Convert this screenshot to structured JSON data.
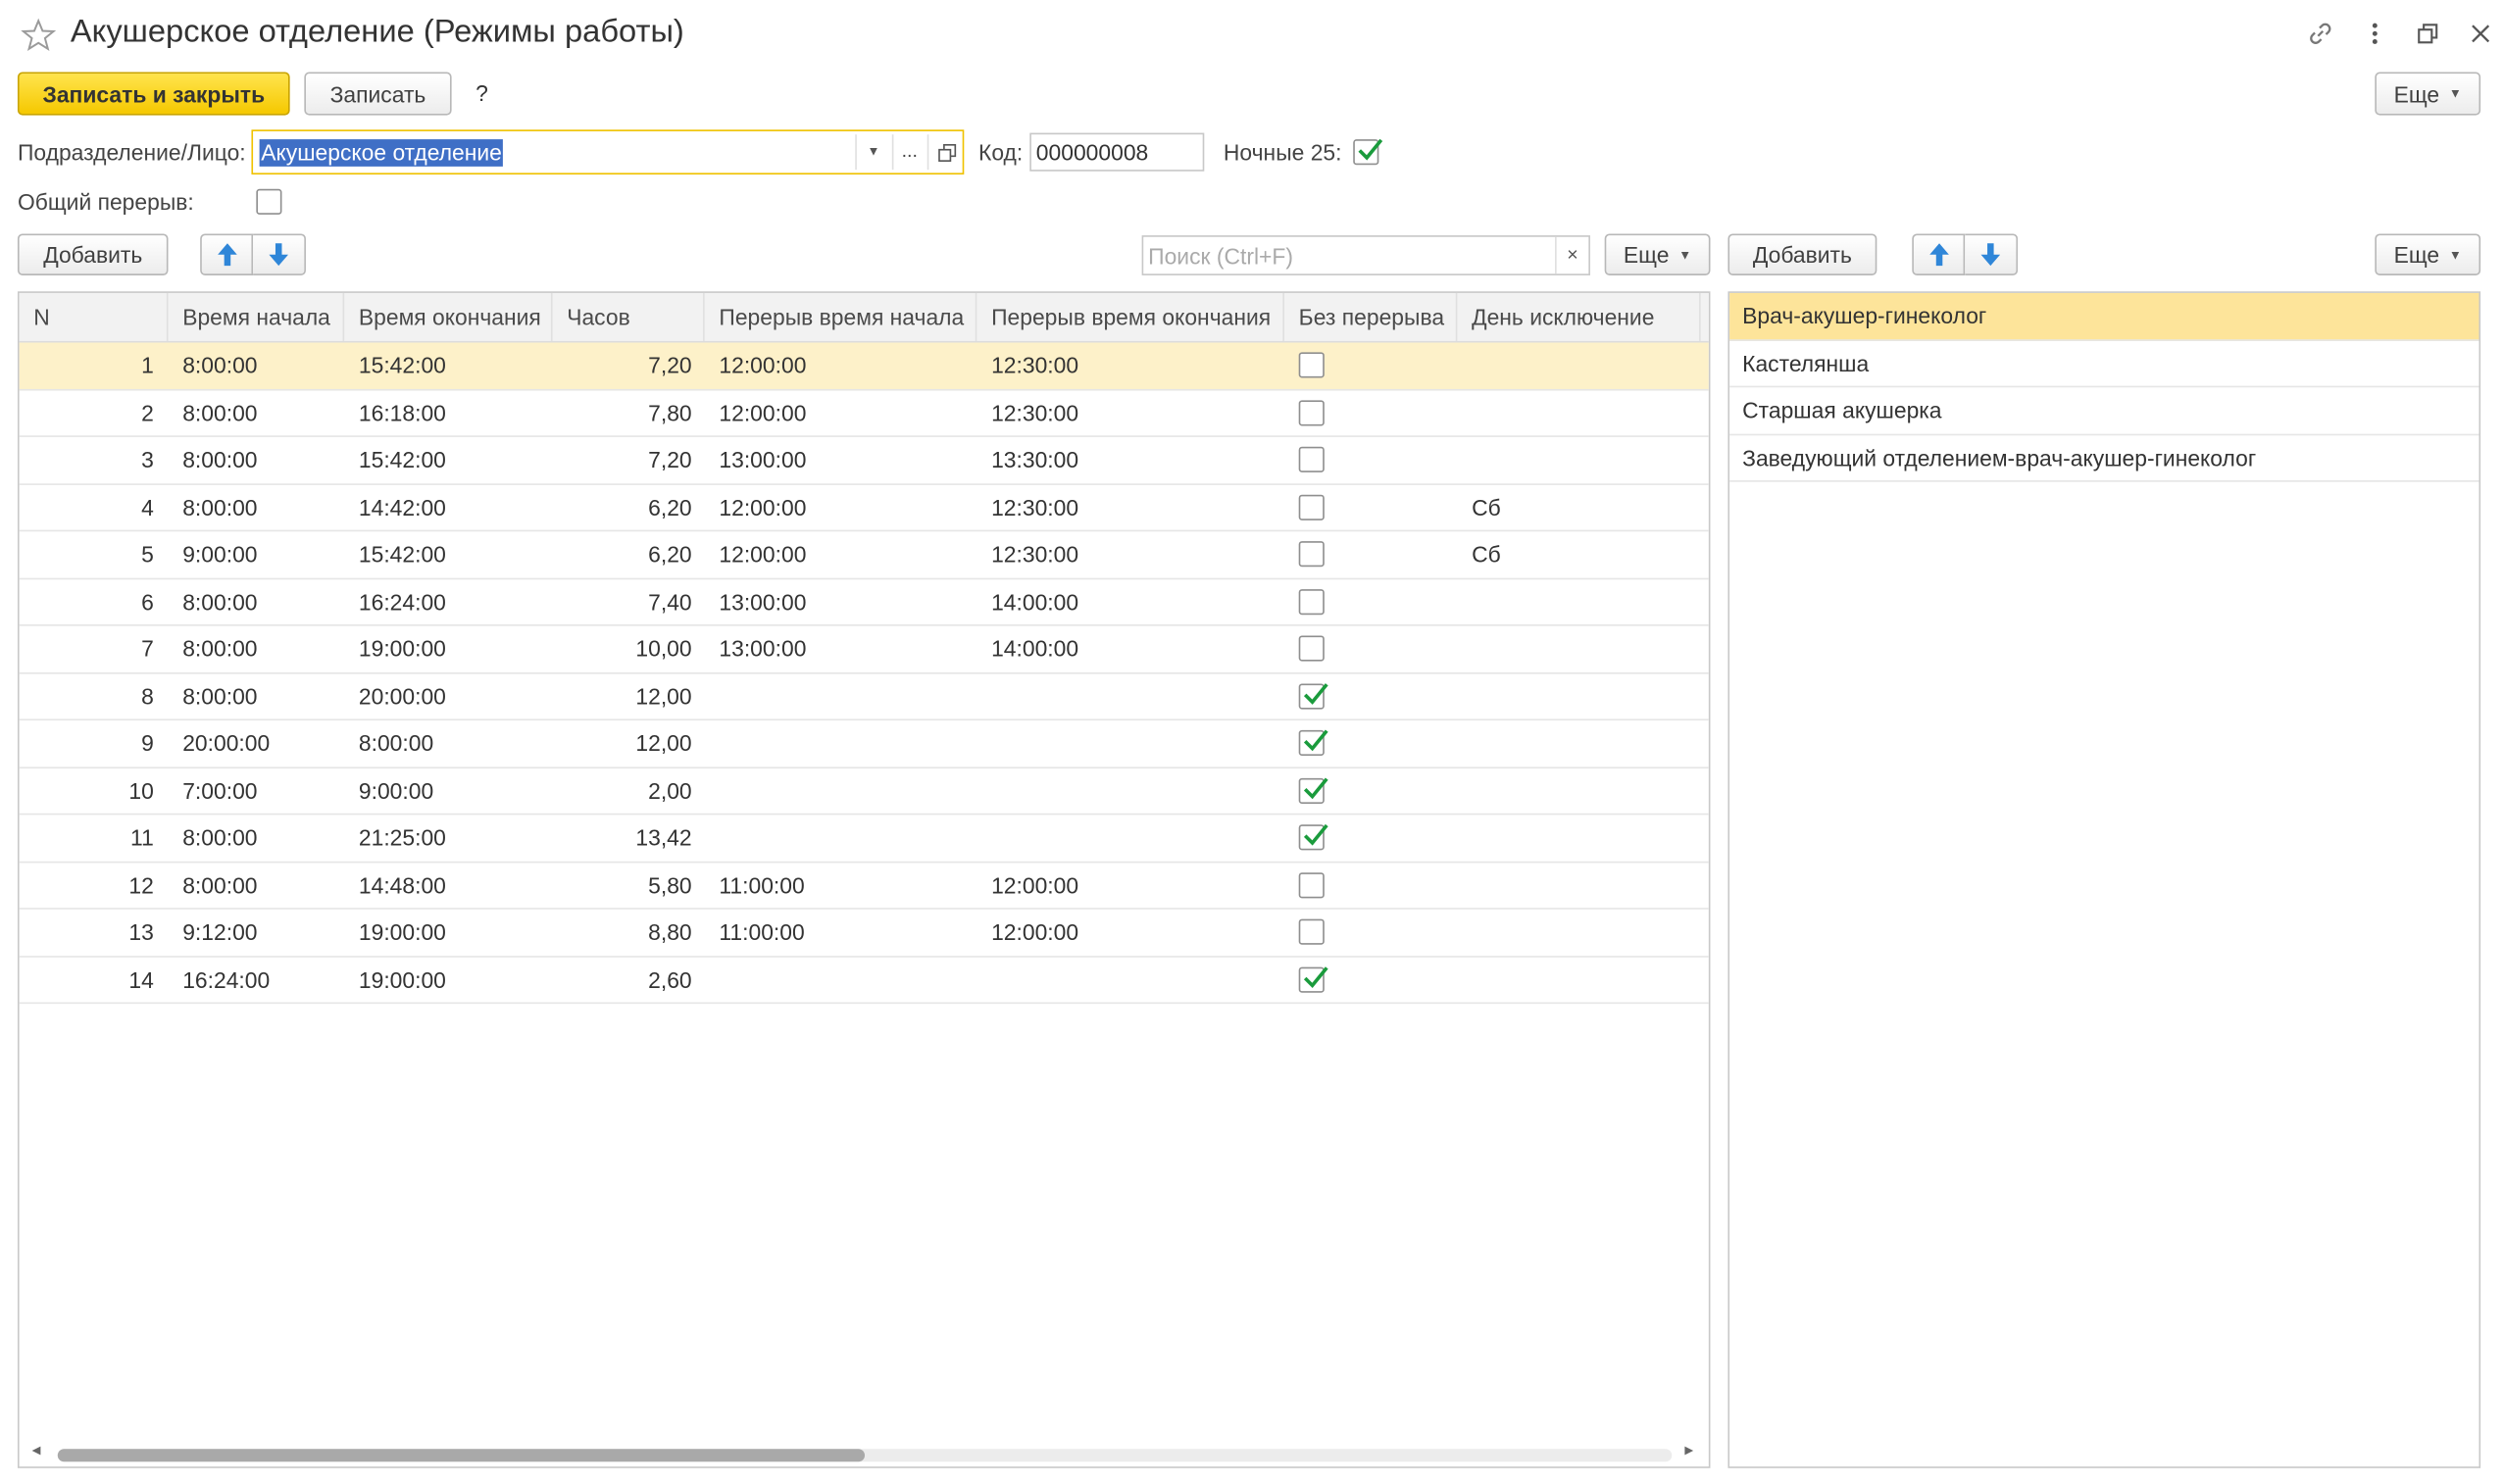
{
  "window": {
    "title": "Акушерское отделение (Режимы работы)"
  },
  "toolbar": {
    "save_close_label": "Записать и закрыть",
    "save_label": "Записать",
    "help_label": "?",
    "more_label": "Еще"
  },
  "form": {
    "division_label": "Подразделение/Лицо:",
    "division_value": "Акушерское отделение",
    "code_label": "Код:",
    "code_value": "000000008",
    "night_label": "Ночные 25:",
    "night_checked": true,
    "common_break_label": "Общий перерыв:",
    "common_break_checked": false
  },
  "left_panel": {
    "add_label": "Добавить",
    "search_placeholder": "Поиск (Ctrl+F)",
    "more_label": "Еще",
    "columns": [
      "N",
      "Время начала",
      "Время окончания",
      "Часов",
      "Перерыв время начала",
      "Перерыв время окончания",
      "Без перерыва",
      "День исключение"
    ],
    "selected_row": 0,
    "scroll_fraction_visible": 0.5,
    "rows": [
      {
        "n": "1",
        "start": "8:00:00",
        "end": "15:42:00",
        "hours": "7,20",
        "break_start": "12:00:00",
        "break_end": "12:30:00",
        "no_break": false,
        "exception_day": ""
      },
      {
        "n": "2",
        "start": "8:00:00",
        "end": "16:18:00",
        "hours": "7,80",
        "break_start": "12:00:00",
        "break_end": "12:30:00",
        "no_break": false,
        "exception_day": ""
      },
      {
        "n": "3",
        "start": "8:00:00",
        "end": "15:42:00",
        "hours": "7,20",
        "break_start": "13:00:00",
        "break_end": "13:30:00",
        "no_break": false,
        "exception_day": ""
      },
      {
        "n": "4",
        "start": "8:00:00",
        "end": "14:42:00",
        "hours": "6,20",
        "break_start": "12:00:00",
        "break_end": "12:30:00",
        "no_break": false,
        "exception_day": "Сб"
      },
      {
        "n": "5",
        "start": "9:00:00",
        "end": "15:42:00",
        "hours": "6,20",
        "break_start": "12:00:00",
        "break_end": "12:30:00",
        "no_break": false,
        "exception_day": "Сб"
      },
      {
        "n": "6",
        "start": "8:00:00",
        "end": "16:24:00",
        "hours": "7,40",
        "break_start": "13:00:00",
        "break_end": "14:00:00",
        "no_break": false,
        "exception_day": ""
      },
      {
        "n": "7",
        "start": "8:00:00",
        "end": "19:00:00",
        "hours": "10,00",
        "break_start": "13:00:00",
        "break_end": "14:00:00",
        "no_break": false,
        "exception_day": ""
      },
      {
        "n": "8",
        "start": "8:00:00",
        "end": "20:00:00",
        "hours": "12,00",
        "break_start": "",
        "break_end": "",
        "no_break": true,
        "exception_day": ""
      },
      {
        "n": "9",
        "start": "20:00:00",
        "end": "8:00:00",
        "hours": "12,00",
        "break_start": "",
        "break_end": "",
        "no_break": true,
        "exception_day": ""
      },
      {
        "n": "10",
        "start": "7:00:00",
        "end": "9:00:00",
        "hours": "2,00",
        "break_start": "",
        "break_end": "",
        "no_break": true,
        "exception_day": ""
      },
      {
        "n": "11",
        "start": "8:00:00",
        "end": "21:25:00",
        "hours": "13,42",
        "break_start": "",
        "break_end": "",
        "no_break": true,
        "exception_day": ""
      },
      {
        "n": "12",
        "start": "8:00:00",
        "end": "14:48:00",
        "hours": "5,80",
        "break_start": "11:00:00",
        "break_end": "12:00:00",
        "no_break": false,
        "exception_day": ""
      },
      {
        "n": "13",
        "start": "9:12:00",
        "end": "19:00:00",
        "hours": "8,80",
        "break_start": "11:00:00",
        "break_end": "12:00:00",
        "no_break": false,
        "exception_day": ""
      },
      {
        "n": "14",
        "start": "16:24:00",
        "end": "19:00:00",
        "hours": "2,60",
        "break_start": "",
        "break_end": "",
        "no_break": true,
        "exception_day": ""
      }
    ]
  },
  "right_panel": {
    "add_label": "Добавить",
    "more_label": "Еще",
    "selected_item": 0,
    "items": [
      "Врач-акушер-гинеколог",
      "Кастелянша",
      "Старшая акушерка",
      "Заведующий отделением-врач-акушер-гинеколог"
    ]
  },
  "colors": {
    "accent_yellow": "#f5c800",
    "selected_row": "#fdf1c9",
    "selected_list_item": "#fde49a",
    "check_green": "#1a9b3c",
    "arrow_blue": "#2f86d8"
  }
}
